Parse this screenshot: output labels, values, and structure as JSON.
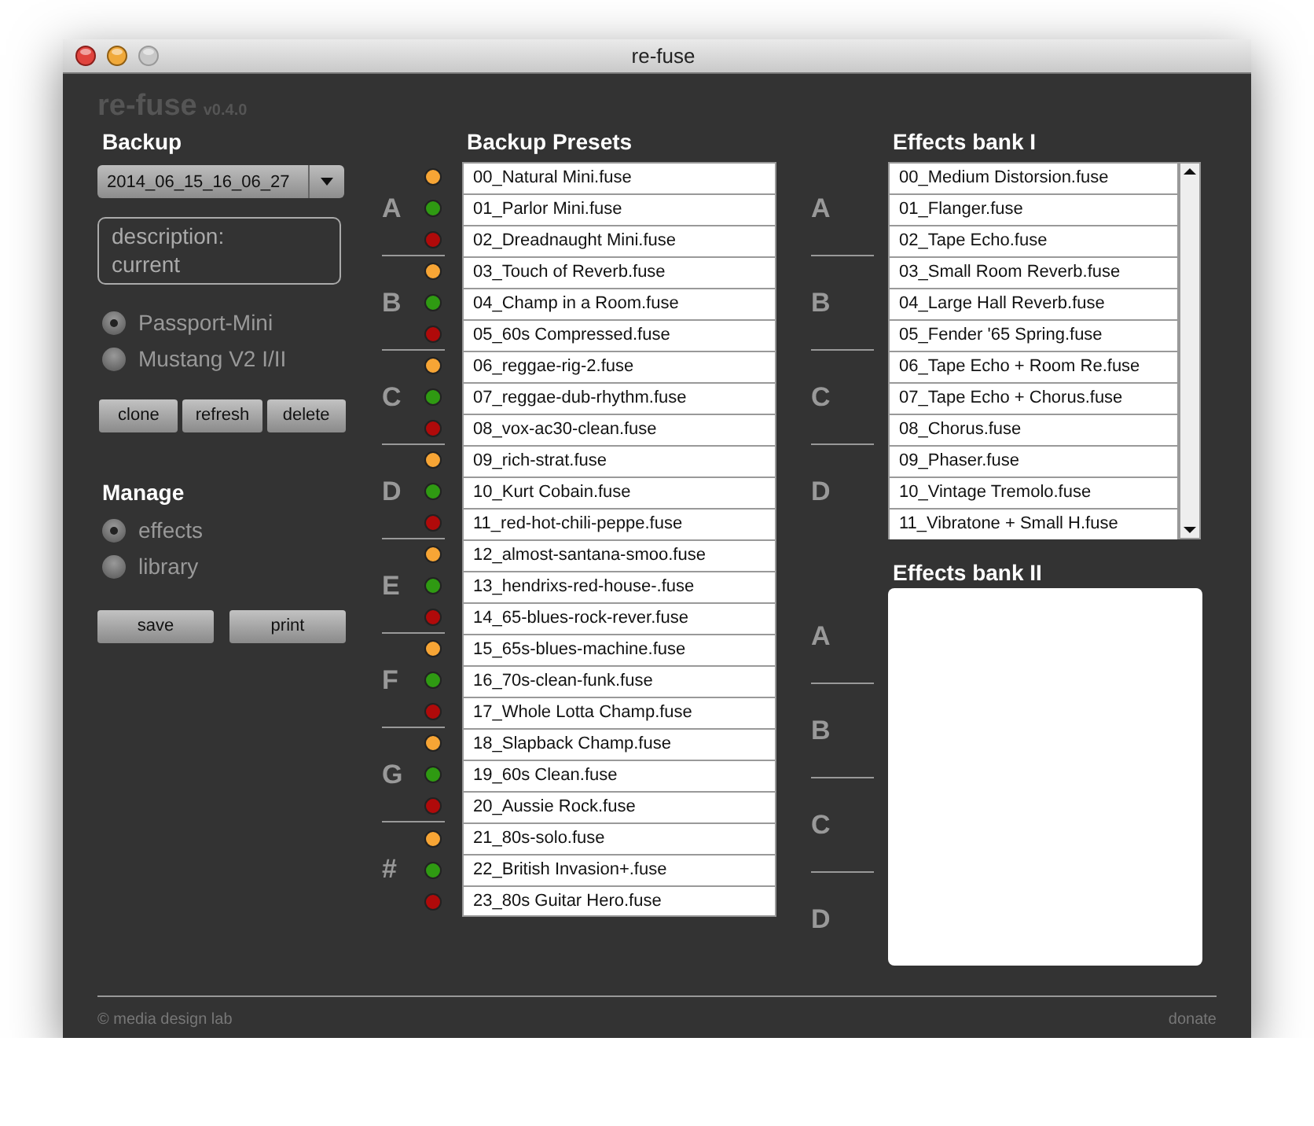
{
  "window": {
    "title": "re-fuse"
  },
  "app": {
    "name": "re-fuse",
    "version": "v0.4.0"
  },
  "backup": {
    "heading": "Backup",
    "dropdown": {
      "value": "2014_06_15_16_06_27"
    },
    "description": "description:\ncurrent",
    "devices": [
      {
        "label": "Passport-Mini",
        "selected": true
      },
      {
        "label": "Mustang V2 I/II",
        "selected": false
      }
    ],
    "buttons": [
      "clone",
      "refresh",
      "delete"
    ]
  },
  "manage": {
    "heading": "Manage",
    "options": [
      {
        "label": "effects",
        "selected": true
      },
      {
        "label": "library",
        "selected": false
      }
    ],
    "buttons": [
      "save",
      "print"
    ]
  },
  "presets": {
    "heading": "Backup Presets",
    "groups": [
      {
        "letter": "A",
        "items": [
          {
            "name": "00_Natural Mini.fuse",
            "color": "#f7a535"
          },
          {
            "name": "01_Parlor Mini.fuse",
            "color": "#2f9a12"
          },
          {
            "name": "02_Dreadnaught Mini.fuse",
            "color": "#b00a0a"
          }
        ]
      },
      {
        "letter": "B",
        "items": [
          {
            "name": "03_Touch of Reverb.fuse",
            "color": "#f7a535"
          },
          {
            "name": "04_Champ in a Room.fuse",
            "color": "#2f9a12"
          },
          {
            "name": "05_60s Compressed.fuse",
            "color": "#b00a0a"
          }
        ]
      },
      {
        "letter": "C",
        "items": [
          {
            "name": "06_reggae-rig-2.fuse",
            "color": "#f7a535"
          },
          {
            "name": "07_reggae-dub-rhythm.fuse",
            "color": "#2f9a12"
          },
          {
            "name": "08_vox-ac30-clean.fuse",
            "color": "#b00a0a"
          }
        ]
      },
      {
        "letter": "D",
        "items": [
          {
            "name": "09_rich-strat.fuse",
            "color": "#f7a535"
          },
          {
            "name": "10_Kurt Cobain.fuse",
            "color": "#2f9a12"
          },
          {
            "name": "11_red-hot-chili-peppe.fuse",
            "color": "#b00a0a"
          }
        ]
      },
      {
        "letter": "E",
        "items": [
          {
            "name": "12_almost-santana-smoo.fuse",
            "color": "#f7a535"
          },
          {
            "name": "13_hendrixs-red-house-.fuse",
            "color": "#2f9a12"
          },
          {
            "name": "14_65-blues-rock-rever.fuse",
            "color": "#b00a0a"
          }
        ]
      },
      {
        "letter": "F",
        "items": [
          {
            "name": "15_65s-blues-machine.fuse",
            "color": "#f7a535"
          },
          {
            "name": "16_70s-clean-funk.fuse",
            "color": "#2f9a12"
          },
          {
            "name": "17_Whole Lotta Champ.fuse",
            "color": "#b00a0a"
          }
        ]
      },
      {
        "letter": "G",
        "items": [
          {
            "name": "18_Slapback Champ.fuse",
            "color": "#f7a535"
          },
          {
            "name": "19_60s Clean.fuse",
            "color": "#2f9a12"
          },
          {
            "name": "20_Aussie Rock.fuse",
            "color": "#b00a0a"
          }
        ]
      },
      {
        "letter": "#",
        "items": [
          {
            "name": "21_80s-solo.fuse",
            "color": "#f7a535"
          },
          {
            "name": "22_British Invasion+.fuse",
            "color": "#2f9a12"
          },
          {
            "name": "23_80s Guitar Hero.fuse",
            "color": "#b00a0a"
          }
        ]
      }
    ]
  },
  "effects_bank_1": {
    "heading": "Effects bank I",
    "groups": [
      {
        "letter": "A",
        "items": [
          "00_Medium Distorsion.fuse",
          "01_Flanger.fuse",
          "02_Tape Echo.fuse"
        ]
      },
      {
        "letter": "B",
        "items": [
          "03_Small Room Reverb.fuse",
          "04_Large Hall Reverb.fuse",
          "05_Fender '65 Spring.fuse"
        ]
      },
      {
        "letter": "C",
        "items": [
          "06_Tape Echo + Room Re.fuse",
          "07_Tape Echo + Chorus.fuse",
          "08_Chorus.fuse"
        ]
      },
      {
        "letter": "D",
        "items": [
          "09_Phaser.fuse",
          "10_Vintage Tremolo.fuse",
          "11_Vibratone + Small H.fuse"
        ]
      }
    ]
  },
  "effects_bank_2": {
    "heading": "Effects bank II",
    "groups": [
      {
        "letter": "A"
      },
      {
        "letter": "B"
      },
      {
        "letter": "C"
      },
      {
        "letter": "D"
      }
    ]
  },
  "footer": {
    "copyright": "© media design lab",
    "link": "donate"
  }
}
